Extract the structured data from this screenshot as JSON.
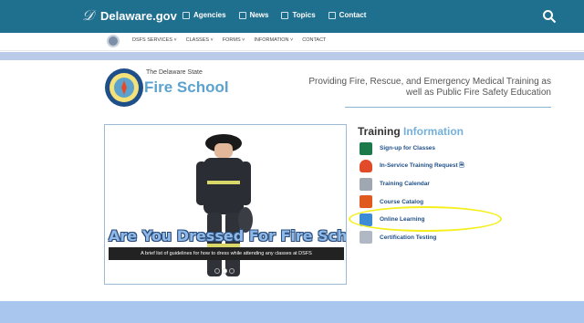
{
  "topbar": {
    "brand": "Delaware.gov",
    "nav": [
      {
        "label": "Agencies"
      },
      {
        "label": "News"
      },
      {
        "label": "Topics"
      },
      {
        "label": "Contact"
      }
    ]
  },
  "subnav": {
    "items": [
      {
        "label": "DSFS SERVICES ˅"
      },
      {
        "label": "CLASSES ˅"
      },
      {
        "label": "FORMS ˅"
      },
      {
        "label": "INFORMATION ˅"
      },
      {
        "label": "CONTACT"
      }
    ]
  },
  "header": {
    "small_text": "The Delaware State",
    "title": "Fire School",
    "tagline": "Providing Fire, Rescue, and Emergency Medical Training as well as Public Fire Safety Education"
  },
  "carousel": {
    "title": "Are You Dressed For Fire School?",
    "caption": "A brief list of guidelines for how to dress while attending any classes at DSFS",
    "active_index": 1,
    "count": 3
  },
  "training": {
    "title_a": "Training",
    "title_b": "Information",
    "items": [
      {
        "label": "Sign-up for Classes",
        "icon": "chart-icon",
        "color": "#1c7a4a"
      },
      {
        "label": "In-Service Training Request",
        "icon": "fire-icon",
        "color": "#e24b2a"
      },
      {
        "label": "Training Calendar",
        "icon": "calendar-icon",
        "color": "#9fa7b0"
      },
      {
        "label": "Course Catalog",
        "icon": "book-icon",
        "color": "#e05a1f"
      },
      {
        "label": "Online Learning",
        "icon": "laptop-icon",
        "color": "#3d8bd6"
      },
      {
        "label": "Certification Testing",
        "icon": "certificate-icon",
        "color": "#b0b8c4"
      }
    ]
  },
  "colors": {
    "topbar": "#1f6f8e",
    "accent": "#5ba2cf",
    "highlight": "#f4ef1d",
    "footer": "#a9c6ee"
  }
}
